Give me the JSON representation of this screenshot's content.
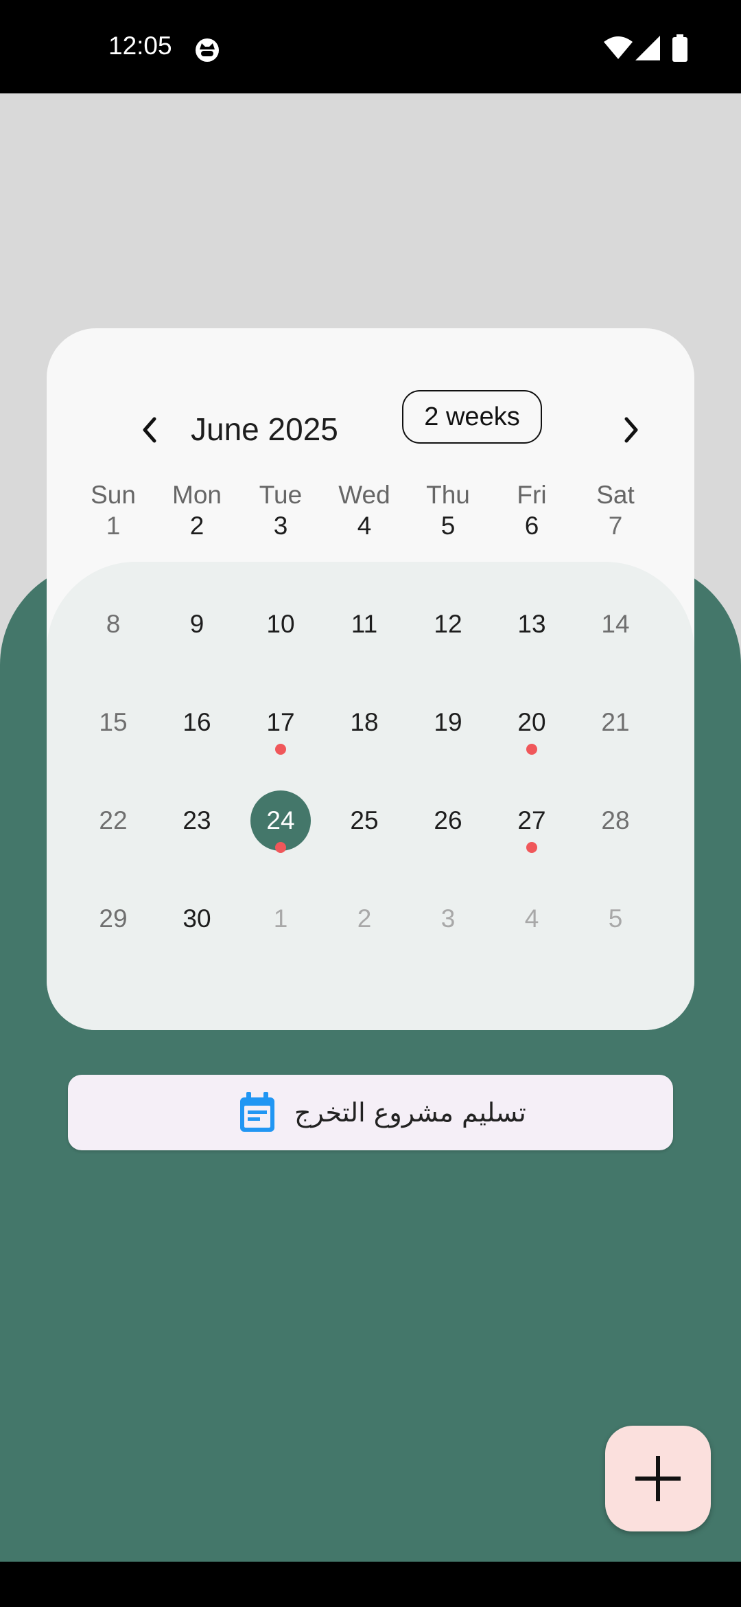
{
  "status_bar": {
    "time": "12:05",
    "icons": [
      "cat-notification-icon",
      "wifi-icon",
      "signal-icon",
      "battery-icon"
    ]
  },
  "calendar": {
    "month_title": "June 2025",
    "format_button": "2 weeks",
    "prev_icon": "chevron-left-icon",
    "next_icon": "chevron-right-icon",
    "days_of_week": [
      "Sun",
      "Mon",
      "Tue",
      "Wed",
      "Thu",
      "Fri",
      "Sat"
    ],
    "weeks": [
      [
        "1",
        "2",
        "3",
        "4",
        "5",
        "6",
        "7"
      ],
      [
        "8",
        "9",
        "10",
        "11",
        "12",
        "13",
        "14"
      ],
      [
        "15",
        "16",
        "17",
        "18",
        "19",
        "20",
        "21"
      ],
      [
        "22",
        "23",
        "24",
        "25",
        "26",
        "27",
        "28"
      ],
      [
        "29",
        "30",
        "1",
        "2",
        "3",
        "4",
        "5"
      ]
    ],
    "selected_day": "24",
    "event_days": [
      "17",
      "20",
      "24",
      "27"
    ]
  },
  "event": {
    "icon": "calendar-event-icon",
    "title": "تسليم مشروع التخرج"
  },
  "fab": {
    "icon": "plus-icon"
  },
  "colors": {
    "accent_green": "#44776a",
    "event_dot": "#f0575a",
    "fab_bg": "#fbe0dd",
    "event_icon": "#2196f3"
  }
}
